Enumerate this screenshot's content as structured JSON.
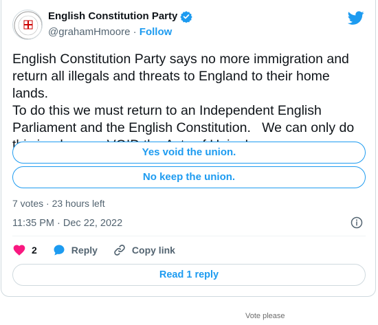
{
  "tweet": {
    "author_name": "English Constitution Party",
    "verified": true,
    "handle": "@grahamHmoore",
    "separator": "·",
    "follow_label": "Follow",
    "avatar_text": {
      "top": "THE CONSTITUTION",
      "middle": "ENGLISH",
      "sub": "PARTY",
      "bottom": "IS THE SOLUTION"
    },
    "text": "English Constitution Party says no more immigration and\nreturn all illegals and threats to England to their home lands.\nTo do this we must return to an Independent English\nParliament and the English Constitution.   We can only do\nthis is when we VOID the Acts of Union!",
    "timestamp": "11:35 PM · Dec 22, 2022"
  },
  "poll": {
    "options": [
      {
        "label": "Yes void the union."
      },
      {
        "label": "No keep the union."
      }
    ],
    "meta": "7 votes · 23 hours left"
  },
  "actions": {
    "likes_count": "2",
    "reply_label": "Reply",
    "copy_link_label": "Copy link"
  },
  "read_reply_label": "Read 1 reply",
  "caption": "Vote please",
  "colors": {
    "accent": "#1d9bf0",
    "like": "#f91880",
    "text": "#0f1419",
    "muted": "#536471",
    "border": "#cfd9de"
  },
  "icons": [
    "verified-badge-icon",
    "twitter-bird-icon",
    "info-icon",
    "heart-icon",
    "reply-bubble-icon",
    "link-icon"
  ]
}
